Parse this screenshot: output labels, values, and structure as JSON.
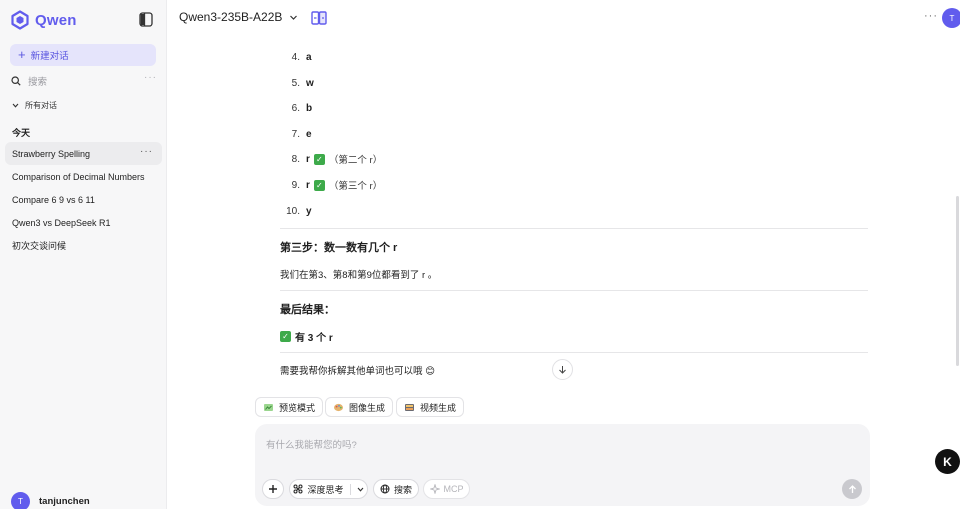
{
  "brand": {
    "name": "Qwen"
  },
  "sidebar": {
    "new_chat": "新建对话",
    "search_placeholder": "搜索",
    "all_chats": "所有对话",
    "section_today": "今天",
    "conversations": [
      "Strawberry Spelling",
      "Comparison of Decimal Numbers",
      "Compare 6 9 vs 6 11",
      "Qwen3 vs DeepSeek R1",
      "初次交谈问候"
    ],
    "user": {
      "initial": "T",
      "name": "tanjunchen"
    }
  },
  "header": {
    "model": "Qwen3-235B-A22B",
    "avatar_initial": "T"
  },
  "message": {
    "letters": [
      {
        "num": "4.",
        "char": "a"
      },
      {
        "num": "5.",
        "char": "w"
      },
      {
        "num": "6.",
        "char": "b"
      },
      {
        "num": "7.",
        "char": "e"
      },
      {
        "num": "8.",
        "char": "r",
        "check": "✓",
        "note": "（第二个 r）"
      },
      {
        "num": "9.",
        "char": "r",
        "check": "✓",
        "note": "（第三个 r）"
      },
      {
        "num": "10.",
        "char": "y"
      }
    ],
    "step3_title": "第三步：数一数有几个 r",
    "step3_text": "我们在第3、第8和第9位都看到了 r 。",
    "final_title": "最后结果：",
    "final_check": "✓",
    "final_text": "有 3 个 r",
    "closing": "需要我帮你拆解其他单词也可以哦 😊"
  },
  "actions": [
    "预览模式",
    "图像生成",
    "视频生成"
  ],
  "composer": {
    "placeholder": "有什么我能帮您的吗?",
    "deep_think": "深度思考",
    "search": "搜索",
    "mcp": "MCP"
  },
  "floating_badge": "K",
  "colors": {
    "accent": "#615ced",
    "accent_bg": "#e5e4fb",
    "check": "#3daa4a"
  }
}
